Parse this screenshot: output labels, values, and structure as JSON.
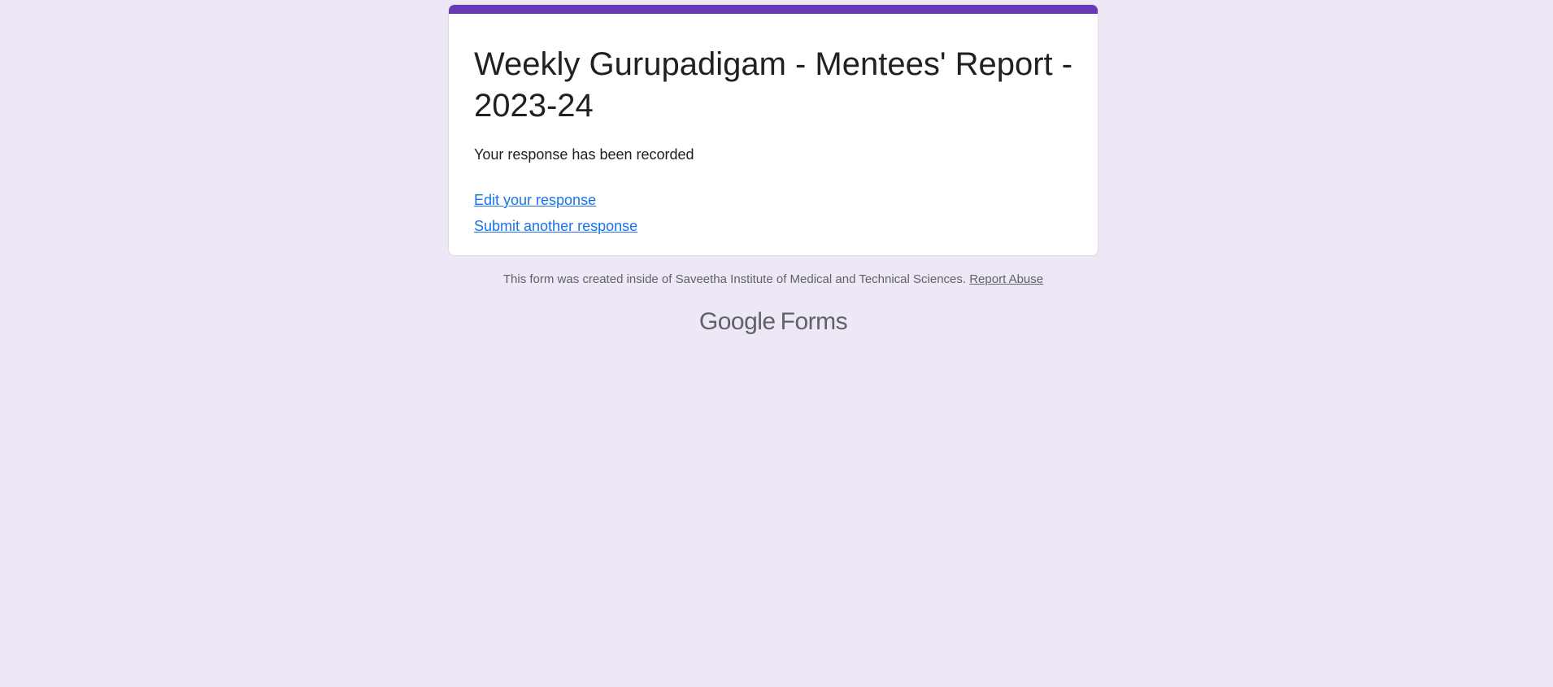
{
  "form": {
    "title": "Weekly Gurupadigam - Mentees' Report - 2023-24",
    "confirmation_message": "Your response has been recorded",
    "edit_link": "Edit your response",
    "submit_another_link": "Submit another response"
  },
  "footer": {
    "created_text": "This form was created inside of Saveetha Institute of Medical and Technical Sciences.",
    "report_abuse": "Report Abuse"
  },
  "brand": {
    "google": "Google",
    "product": "Forms"
  },
  "colors": {
    "background": "#ede7f6",
    "accent": "#673ab7",
    "link": "#1a73e8",
    "muted_text": "#5f6368"
  }
}
